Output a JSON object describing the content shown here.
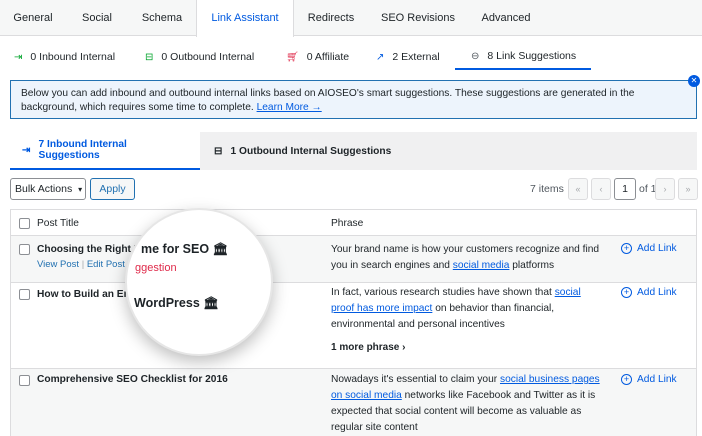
{
  "tabs": [
    "General",
    "Social",
    "Schema",
    "Link Assistant",
    "Redirects",
    "SEO Revisions",
    "Advanced"
  ],
  "subtabs": [
    {
      "icon": "inbound-icon",
      "label": "0 Inbound Internal"
    },
    {
      "icon": "outbound-icon",
      "label": "0 Outbound Internal"
    },
    {
      "icon": "cart-icon",
      "label": "0 Affiliate"
    },
    {
      "icon": "external-icon",
      "label": "2 External"
    },
    {
      "icon": "link-icon",
      "label": "8 Link Suggestions"
    }
  ],
  "notice": {
    "text": "Below you can add inbound and outbound internal links based on AIOSEO's smart suggestions. These suggestions are generated in the background, which requires some time to complete.",
    "link": "Learn More →"
  },
  "inner_tabs": [
    "7 Inbound Internal Suggestions",
    "1 Outbound Internal Suggestions"
  ],
  "toolbar": {
    "bulk_actions": "Bulk Actions",
    "apply": "Apply",
    "items": "7 items",
    "page": "1",
    "of": "of 1",
    "first": "«",
    "prev": "‹",
    "next": "›",
    "last": "»"
  },
  "table": {
    "col_post": "Post Title",
    "col_phrase": "Phrase",
    "rows": [
      {
        "title": "Choosing the Right Do",
        "actions": [
          "View Post",
          "Edit Post",
          "D"
        ],
        "phrase_pre": "Your brand name is how your customers recognize and find you in search engines and ",
        "phrase_link": "social media",
        "phrase_post": " platforms",
        "add": "Add Link"
      },
      {
        "title": "How to Build an Ema",
        "phrase_pre": "In fact, various research studies have shown that ",
        "phrase_link": "social proof has more impact",
        "phrase_post": " on behavior than financial, environmental and personal incentives",
        "more": "1 more phrase ›",
        "add": "Add Link"
      },
      {
        "title": "Comprehensive SEO Checklist for 2016",
        "phrase_pre": "Nowadays it's essential to claim your ",
        "phrase_link": "social business pages on social media",
        "phrase_post": " networks like Facebook and Twitter as it is expected that social content will become as valuable as regular site content",
        "add": "Add Link"
      }
    ]
  },
  "magnifier": {
    "line1": "me for SEO",
    "line2": "ggestion",
    "line3": "WordPress"
  }
}
